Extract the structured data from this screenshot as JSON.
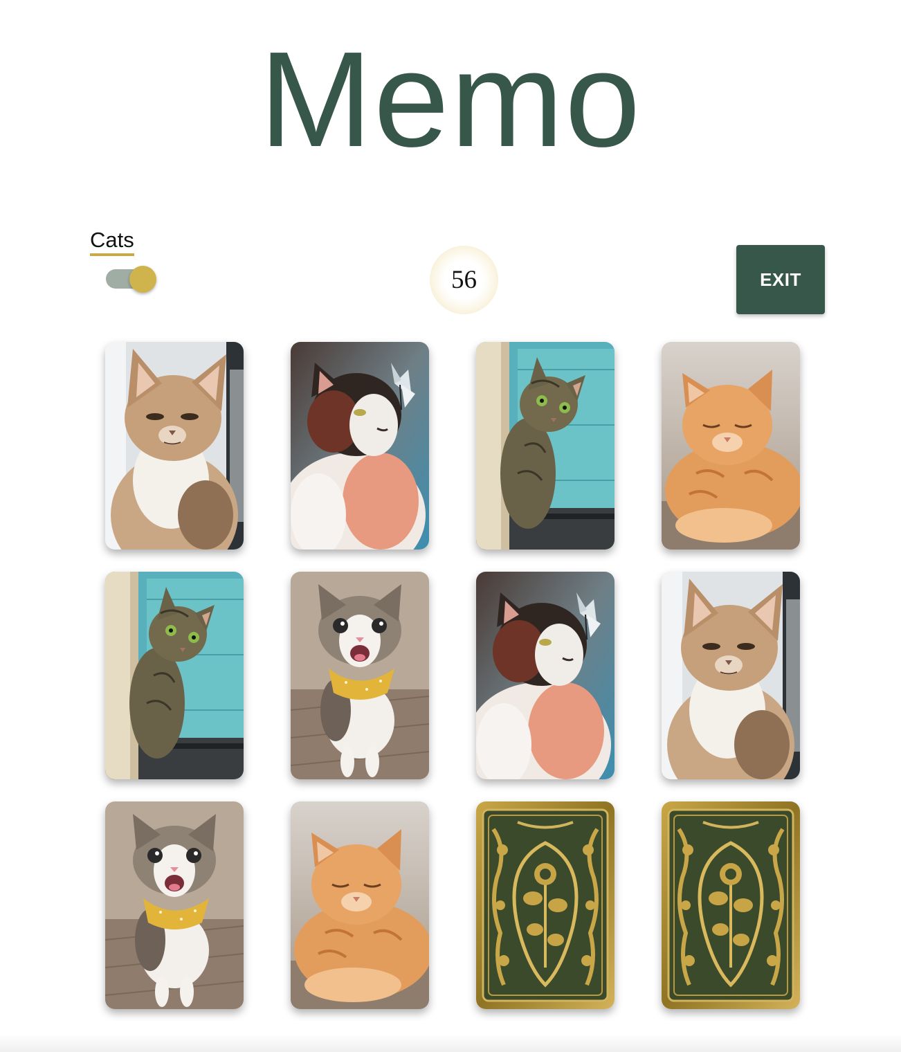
{
  "header": {
    "title": "Memo"
  },
  "mode": {
    "label": "Cats",
    "toggle_on": true
  },
  "counter": {
    "value": "56"
  },
  "actions": {
    "exit_label": "EXIT"
  },
  "colors": {
    "brand": "#37574a",
    "accent": "#cfb44e",
    "toggle_track": "#9fada5"
  },
  "cards": [
    {
      "face": "up",
      "picture": "grumpy-tan-cat"
    },
    {
      "face": "up",
      "picture": "calico-cat-with-butterfly"
    },
    {
      "face": "up",
      "picture": "tabby-cat-peeking"
    },
    {
      "face": "up",
      "picture": "orange-cat-resting"
    },
    {
      "face": "up",
      "picture": "tabby-cat-peeking"
    },
    {
      "face": "up",
      "picture": "meowing-cat-with-scarf"
    },
    {
      "face": "up",
      "picture": "calico-cat-with-butterfly"
    },
    {
      "face": "up",
      "picture": "grumpy-tan-cat"
    },
    {
      "face": "up",
      "picture": "meowing-cat-with-scarf"
    },
    {
      "face": "up",
      "picture": "orange-cat-resting"
    },
    {
      "face": "down",
      "picture": "ornate-card-back"
    },
    {
      "face": "down",
      "picture": "ornate-card-back"
    }
  ]
}
